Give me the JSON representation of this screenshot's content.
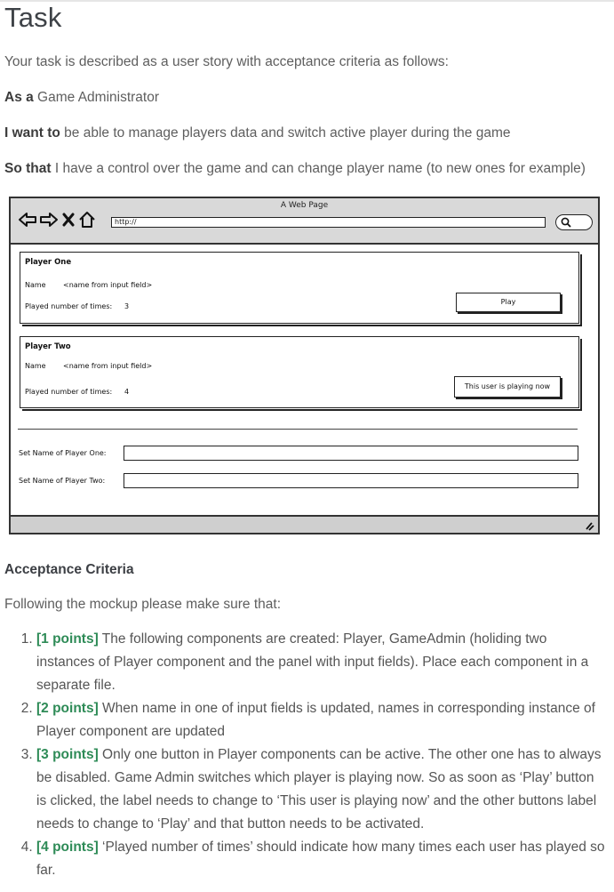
{
  "heading": "Task",
  "intro": "Your task is described as a user story with acceptance criteria as follows:",
  "story": {
    "as_a_label": "As a",
    "as_a_text": " Game Administrator",
    "want_label": "I want to",
    "want_text": " be able to manage players data and switch active player during the game",
    "so_that_label": "So that",
    "so_that_text": " I have a control over the game and can change player name (to new ones for example)"
  },
  "mockup": {
    "window_title": "A Web Page",
    "url": "http://",
    "player_one": {
      "title": "Player One",
      "name_label": "Name",
      "name_value": "<name from input field>",
      "played_label": "Played number of times:",
      "played_value": "3",
      "button": "Play"
    },
    "player_two": {
      "title": "Player Two",
      "name_label": "Name",
      "name_value": "<name from input field>",
      "played_label": "Played number of times:",
      "played_value": "4",
      "button": "This user is playing now"
    },
    "set_name_one_label": "Set Name of Player One:",
    "set_name_two_label": "Set Name of Player Two:",
    "icons": [
      "back-arrow-icon",
      "forward-arrow-icon",
      "close-icon",
      "home-icon",
      "search-icon",
      "resize-grip-icon"
    ]
  },
  "acceptance": {
    "heading": "Acceptance Criteria",
    "intro": "Following the mockup please make sure that:",
    "items": [
      {
        "points": "[1 points]",
        "text": " The following components are created: Player,  GameAdmin (holiding two instances of Player component and  the panel with input fields). Place each component in a separate file."
      },
      {
        "points": "[2 points]",
        "text": " When name in one of input fields is updated, names in corresponding instance of Player component are updated"
      },
      {
        "points": "[3 points]",
        "text": " Only one button in Player components can be active. The other one has to always be disabled. Game Admin switches which player is playing now. So as soon as ‘Play’ button is clicked, the label needs to change to ‘This user is playing now’ and the other buttons label needs to change to ‘Play’ and that button needs to be activated."
      },
      {
        "points": "[4 points]",
        "text": " ‘Played number of times’ should indicate how many times each user has played so far."
      }
    ]
  },
  "colors": {
    "points_accent": "#2e8b57",
    "text": "#555555",
    "heading": "#3e4247"
  }
}
